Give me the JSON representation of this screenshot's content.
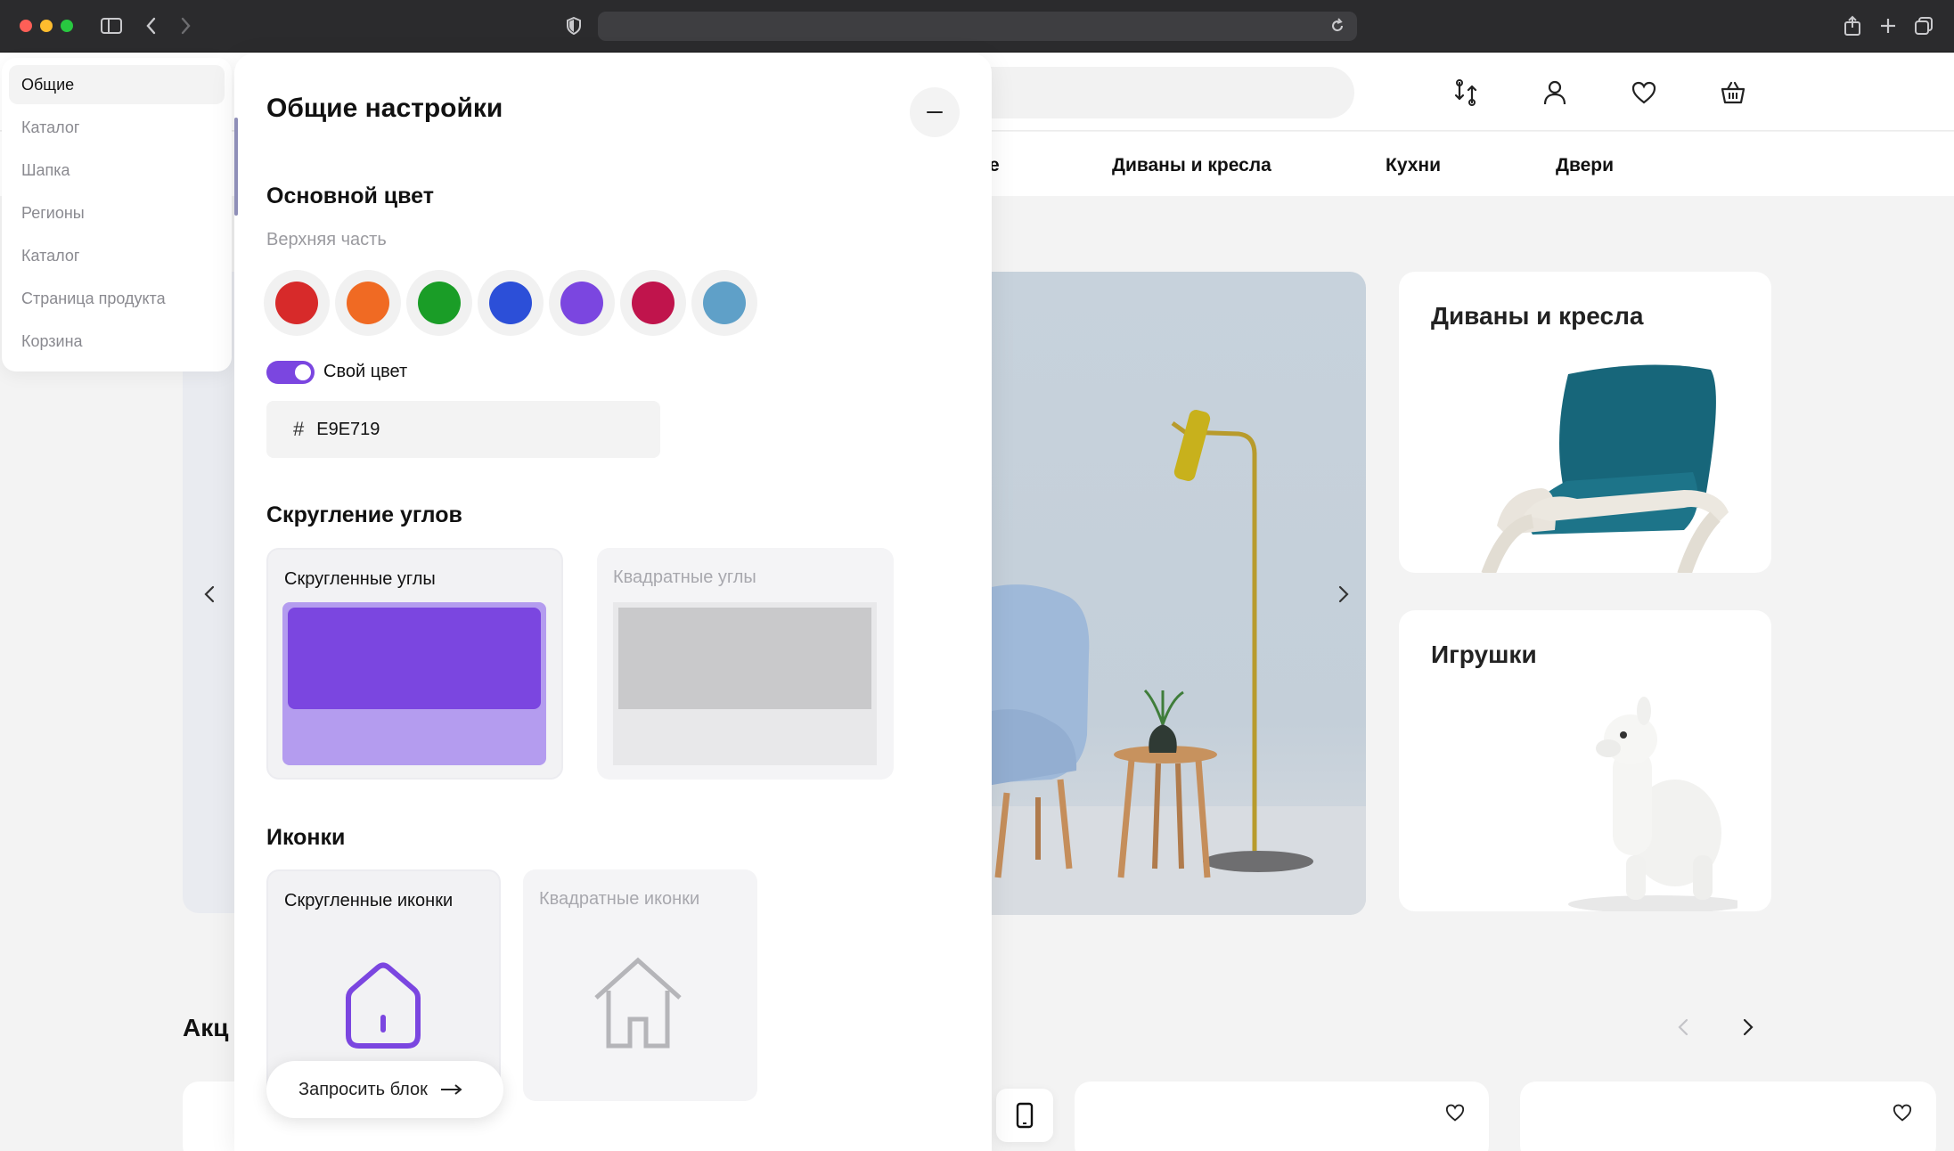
{
  "settings_menu": {
    "items": [
      {
        "label": "Общие"
      },
      {
        "label": "Каталог"
      },
      {
        "label": "Шапка"
      },
      {
        "label": "Регионы"
      },
      {
        "label": "Каталог"
      },
      {
        "label": "Страница продукта"
      },
      {
        "label": "Корзина"
      }
    ],
    "active_index": 0
  },
  "panel": {
    "title": "Общие настройки",
    "main_color": {
      "heading": "Основной цвет",
      "sublabel": "Верхняя часть",
      "swatches": [
        "#d72a2a",
        "#f06a23",
        "#1a9d27",
        "#2c4fd8",
        "#7b46e0",
        "#c0144c",
        "#5fa0c8"
      ],
      "custom_toggle_label": "Свой цвет",
      "custom_toggle_on": true,
      "hex_value": "E9E719"
    },
    "corners": {
      "heading": "Скругление углов",
      "options": [
        {
          "label": "Скругленные углы",
          "selected": true
        },
        {
          "label": "Квадратные углы",
          "selected": false
        }
      ]
    },
    "icons": {
      "heading": "Иконки",
      "options": [
        {
          "label": "Скругленные иконки",
          "selected": true
        },
        {
          "label": "Квадратные иконки",
          "selected": false
        }
      ]
    },
    "request_button": "Запросить блок"
  },
  "site": {
    "nav": [
      "е",
      "Диваны и кресла",
      "Кухни",
      "Двери"
    ],
    "categories": [
      {
        "title": "Диваны и кресла"
      },
      {
        "title": "Игрушки"
      }
    ],
    "promo_title": "Акц"
  },
  "colors": {
    "accent": "#7b46e0",
    "accent_light": "#b49cef",
    "chrome": "#2b2b2d"
  }
}
